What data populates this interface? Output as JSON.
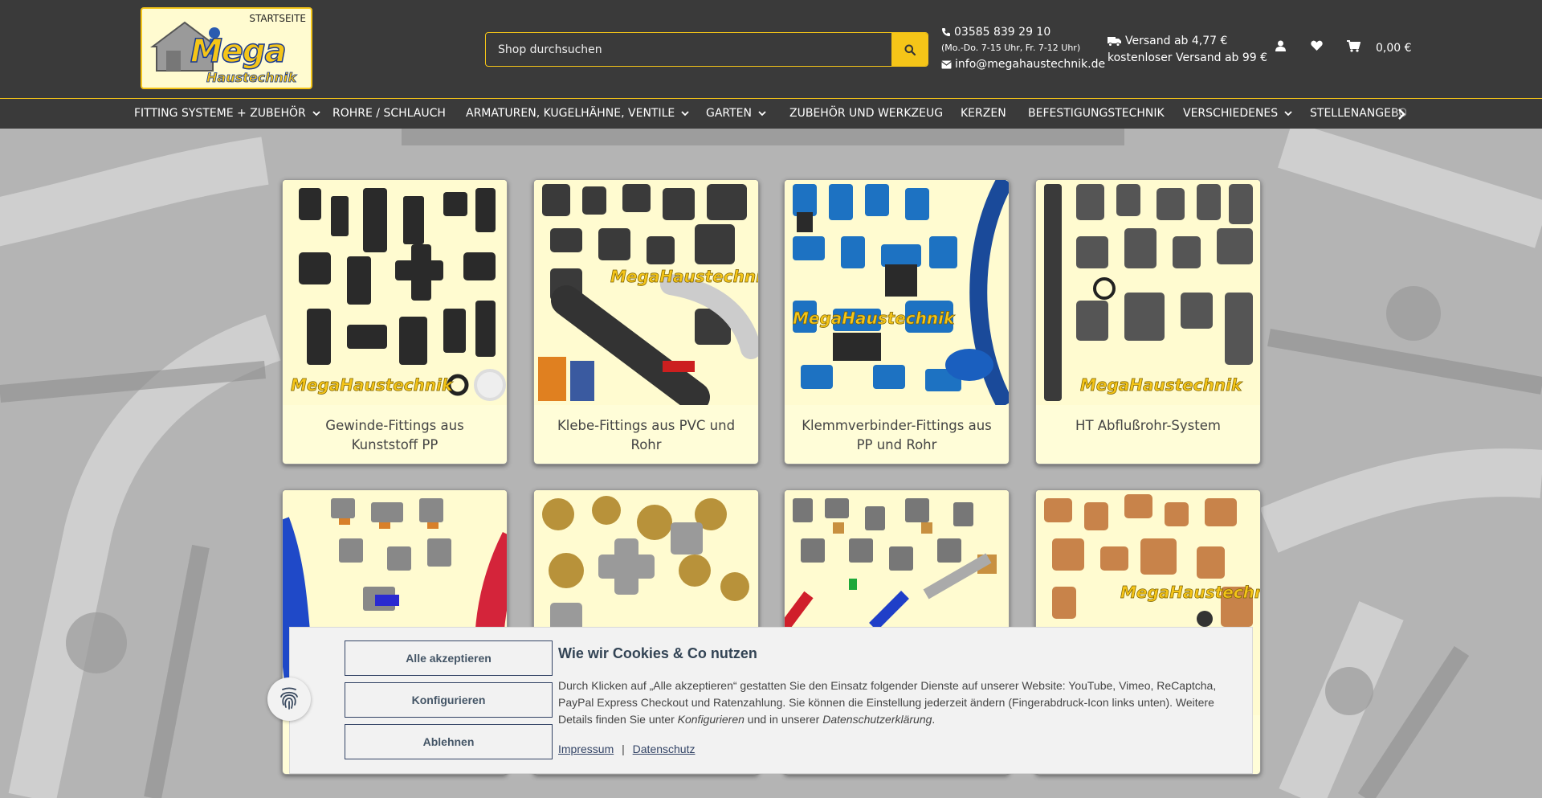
{
  "header": {
    "logo": {
      "brand_line1": "Mega",
      "brand_line2": "Haustechnik",
      "home_label": "STARTSEITE"
    },
    "search": {
      "placeholder": "Shop durchsuchen",
      "icon": "search-icon"
    },
    "contact": {
      "phone": "03585 839 29 10",
      "hours": "(Mo.-Do. 7-15 Uhr, Fr. 7-12 Uhr)",
      "email": "info@megahaustechnik.de"
    },
    "shipping": {
      "line1": "Versand ab 4,77 €",
      "line2": "kostenloser Versand ab 99 €"
    },
    "cart_total": "0,00 €"
  },
  "nav": {
    "items": [
      {
        "label": "FITTING SYSTEME + ZUBEHÖR",
        "dropdown": true
      },
      {
        "label": "ROHRE / SCHLAUCH",
        "dropdown": false
      },
      {
        "label": "ARMATUREN, KUGELHÄHNE, VENTILE",
        "dropdown": true
      },
      {
        "label": "GARTEN",
        "dropdown": true
      },
      {
        "label": "ZUBEHÖR UND WERKZEUG",
        "dropdown": false
      },
      {
        "label": "KERZEN",
        "dropdown": false
      },
      {
        "label": "BEFESTIGUNGSTECHNIK",
        "dropdown": false
      },
      {
        "label": "VERSCHIEDENES",
        "dropdown": true
      },
      {
        "label": "STELLENANGEBOTE",
        "dropdown": false
      }
    ]
  },
  "categories": [
    {
      "label": "Gewinde-Fittings aus Kunststoff PP"
    },
    {
      "label": "Klebe-Fittings aus PVC und Rohr"
    },
    {
      "label": "Klemmverbinder-Fittings aus PP und Rohr"
    },
    {
      "label": "HT Abflußrohr-System"
    },
    {
      "label": ""
    },
    {
      "label": ""
    },
    {
      "label": ""
    },
    {
      "label": ""
    }
  ],
  "watermark": "MegaHaustechnik",
  "cookie": {
    "title": "Wie wir Cookies & Co nutzen",
    "text_1": "Durch Klicken auf „Alle akzeptieren“ gestatten Sie den Einsatz folgender Dienste auf unserer Website: YouTube, Vimeo, ReCaptcha, PayPal Express Checkout und Ratenzahlung. Sie können die Einstellung jederzeit ändern (Fingerabdruck-Icon links unten). Weitere Details finden Sie unter ",
    "text_em1": "Konfigurieren",
    "text_2": " und in unserer ",
    "text_em2": "Datenschutzerklärung",
    "text_3": ".",
    "accept_all": "Alle akzeptieren",
    "configure": "Konfigurieren",
    "decline": "Ablehnen",
    "link_impressum": "Impressum",
    "link_separator": "|",
    "link_datenschutz": "Datenschutz"
  },
  "colors": {
    "header_bg": "#3a3a3a",
    "accent": "#f5c518",
    "card_bg": "#fffdd8"
  }
}
